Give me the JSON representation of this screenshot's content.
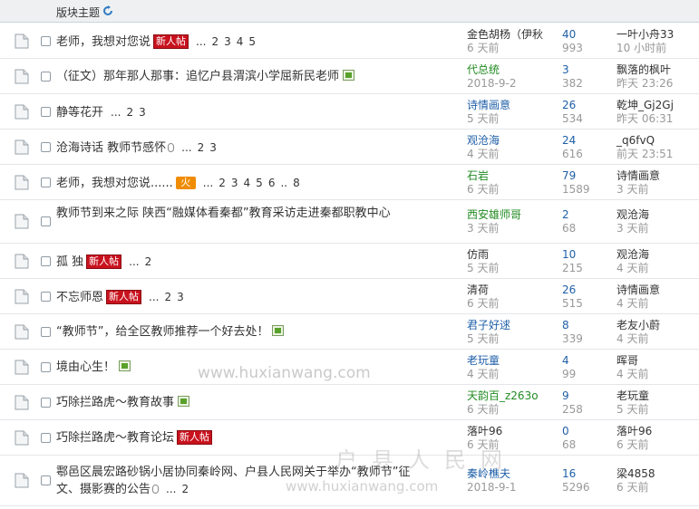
{
  "header": {
    "title": "版块主题"
  },
  "threads": [
    {
      "title": "老师，我想对您说",
      "badge": "新人帖",
      "icon": "",
      "pages": [
        "...",
        "2",
        "3",
        "4",
        "5"
      ],
      "author": "金色胡杨（伊秋",
      "author_color": "black",
      "date": "6 天前",
      "replies": "40",
      "views": "993",
      "last_user": "一叶小舟33",
      "last_time": "10 小时前"
    },
    {
      "title": "（征文）那年那人那事：追忆户县渭滨小学屈新民老师",
      "badge": "",
      "icon": "picture-icon",
      "pages": [],
      "author": "代总统",
      "author_color": "green",
      "date": "2018-9-2",
      "replies": "3",
      "views": "382",
      "last_user": "飘落的枫叶",
      "last_time": "昨天 23:26"
    },
    {
      "title": "静等花开",
      "badge": "",
      "icon": "",
      "pages": [
        "...",
        "2",
        "3"
      ],
      "author": "诗情画意",
      "author_color": "blue",
      "date": "5 天前",
      "replies": "26",
      "views": "534",
      "last_user": "乾坤_Gj2Gj",
      "last_time": "昨天 06:31"
    },
    {
      "title": "沧海诗话 教师节感怀",
      "badge": "",
      "icon": "attachment-icon",
      "pages": [
        "...",
        "2",
        "3"
      ],
      "author": "观沧海",
      "author_color": "blue",
      "date": "4 天前",
      "replies": "24",
      "views": "616",
      "last_user": "_q6fvQ",
      "last_time": "前天 23:51"
    },
    {
      "title": "老师，我想对您说......",
      "badge": "火",
      "icon": "hot-icon",
      "pages": [
        "...",
        "2",
        "3",
        "4",
        "5",
        "6",
        "..",
        "8"
      ],
      "author": "石岩",
      "author_color": "green",
      "date": "6 天前",
      "replies": "79",
      "views": "1589",
      "last_user": "诗情画意",
      "last_time": "3 天前"
    },
    {
      "title": "教师节到来之际 陕西“融媒体看秦都”教育采访走进秦都职教中心",
      "badge": "",
      "icon": "",
      "pages": [],
      "author": "西安雄师哥",
      "author_color": "green",
      "date": "3 天前",
      "replies": "2",
      "views": "68",
      "last_user": "观沧海",
      "last_time": "3 天前"
    },
    {
      "title": "孤 独",
      "badge": "新人帖",
      "icon": "",
      "pages": [
        "...",
        "2"
      ],
      "author": "仿雨",
      "author_color": "black",
      "date": "5 天前",
      "replies": "10",
      "views": "215",
      "last_user": "观沧海",
      "last_time": "4 天前"
    },
    {
      "title": "不忘师恩",
      "badge": "新人帖",
      "icon": "",
      "pages": [
        "...",
        "2",
        "3"
      ],
      "author": "清荷",
      "author_color": "black",
      "date": "6 天前",
      "replies": "26",
      "views": "515",
      "last_user": "诗情画意",
      "last_time": "4 天前"
    },
    {
      "title": "“教师节”，给全区教师推荐一个好去处！",
      "badge": "",
      "icon": "picture-icon",
      "pages": [],
      "author": "君子好逑",
      "author_color": "blue",
      "date": "5 天前",
      "replies": "8",
      "views": "339",
      "last_user": "老友小蔚",
      "last_time": "4 天前"
    },
    {
      "title": "境由心生！",
      "badge": "",
      "icon": "picture-icon",
      "pages": [],
      "author": "老玩童",
      "author_color": "blue",
      "date": "4 天前",
      "replies": "4",
      "views": "99",
      "last_user": "晖哥",
      "last_time": "4 天前"
    },
    {
      "title": "巧除拦路虎～教育故事",
      "badge": "",
      "icon": "picture-icon",
      "pages": [],
      "author": "天韵百_z263o",
      "author_color": "green",
      "date": "6 天前",
      "replies": "9",
      "views": "258",
      "last_user": "老玩童",
      "last_time": "5 天前"
    },
    {
      "title": "巧除拦路虎～教育论坛",
      "badge": "新人帖",
      "icon": "",
      "pages": [],
      "author": "落叶96",
      "author_color": "black",
      "date": "6 天前",
      "replies": "0",
      "views": "68",
      "last_user": "落叶96",
      "last_time": "6 天前"
    },
    {
      "title": "鄠邑区晨宏路砂锅小居协同秦岭网、户县人民网关于举办“教师节”征文、摄影赛的公告",
      "badge": "",
      "icon": "attachment-icon",
      "pages": [
        "...",
        "2"
      ],
      "author": "秦岭樵夫",
      "author_color": "blue",
      "date": "2018-9-1",
      "replies": "16",
      "views": "5296",
      "last_user": "梁4858",
      "last_time": "6 天前"
    }
  ],
  "watermark": {
    "url1": "www.huxianwang.com",
    "site": "户县人民网",
    "url2": "www.huxianwang.com"
  },
  "colors": {
    "link_blue": "#1f5fa8",
    "green": "#228b22",
    "badge_red": "#c8121e",
    "hot_orange": "#f08c00"
  }
}
